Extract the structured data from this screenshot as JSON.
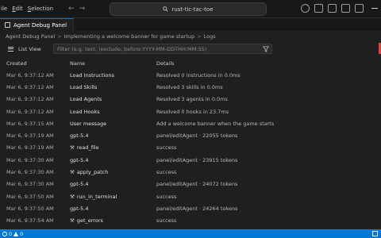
{
  "menu": {
    "items": [
      {
        "label": "ile",
        "underline": ""
      },
      {
        "label": "dit",
        "underline": "E"
      },
      {
        "label": "election",
        "underline": "S"
      }
    ]
  },
  "command_center": {
    "text": "rust-tic-tac-toe",
    "icon": "search-icon"
  },
  "tab": {
    "label": "Agent Debug Panel",
    "icon": "debug-panel-icon"
  },
  "breadcrumb": {
    "items": [
      "Agent Debug Panel",
      "Implementing a welcome banner for game startup",
      "Logs"
    ],
    "separator": ">"
  },
  "toolbar": {
    "list_view_label": "List View",
    "filter_placeholder": "Filter (e.g. text, !exclude, before:YYYY-MM-DDTHH:MM:SS)"
  },
  "table": {
    "headers": {
      "created": "Created",
      "name": "Name",
      "details": "Details"
    },
    "rows": [
      {
        "created": "Mar 6, 9:37:12 AM",
        "name": "Load Instructions",
        "tool": false,
        "details": "Resolved 0 instructions in 0.0ms"
      },
      {
        "created": "Mar 6, 9:37:12 AM",
        "name": "Load Skills",
        "tool": false,
        "details": "Resolved 3 skills in 0.0ms"
      },
      {
        "created": "Mar 6, 9:37:12 AM",
        "name": "Load Agents",
        "tool": false,
        "details": "Resolved 3 agents in 0.0ms"
      },
      {
        "created": "Mar 6, 9:37:12 AM",
        "name": "Load Hooks",
        "tool": false,
        "details": "Resolved 0 hooks in 23.7ms"
      },
      {
        "created": "Mar 6, 9:37:15 AM",
        "name": "User message",
        "tool": false,
        "details": "Add a welcome banner when the game starts"
      },
      {
        "created": "Mar 6, 9:37:19 AM",
        "name": "gpt-5.4",
        "tool": false,
        "details": "panel/editAgent · 22055 tokens"
      },
      {
        "created": "Mar 6, 9:37:19 AM",
        "name": "read_file",
        "tool": true,
        "details": "success"
      },
      {
        "created": "Mar 6, 9:37:30 AM",
        "name": "gpt-5.4",
        "tool": false,
        "details": "panel/editAgent · 23915 tokens"
      },
      {
        "created": "Mar 6, 9:37:30 AM",
        "name": "apply_patch",
        "tool": true,
        "details": "success"
      },
      {
        "created": "Mar 6, 9:37:30 AM",
        "name": "gpt-5.4",
        "tool": false,
        "details": "panel/editAgent · 24072 tokens"
      },
      {
        "created": "Mar 6, 9:37:50 AM",
        "name": "run_in_terminal",
        "tool": true,
        "details": "success"
      },
      {
        "created": "Mar 6, 9:37:50 AM",
        "name": "gpt-5.4",
        "tool": false,
        "details": "panel/editAgent · 24264 tokens"
      },
      {
        "created": "Mar 6, 9:37:54 AM",
        "name": "get_errors",
        "tool": true,
        "details": "success"
      }
    ]
  },
  "statusbar": {
    "errors": "0",
    "warnings": "0"
  },
  "colors": {
    "accent": "#0078d4",
    "background": "#1f1f1f",
    "titlebar": "#181818"
  },
  "icons": {
    "tool": "tools-icon"
  }
}
